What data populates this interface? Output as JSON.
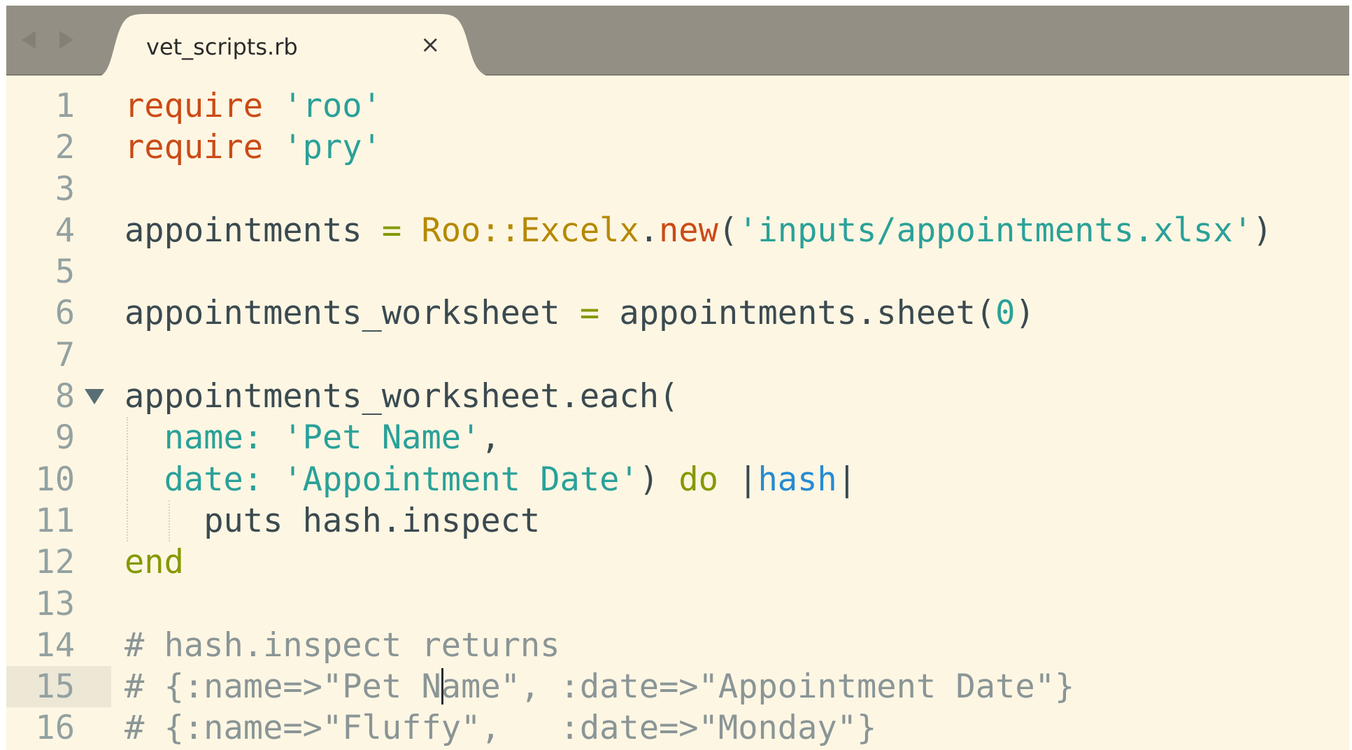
{
  "tab": {
    "title": "vet_scripts.rb",
    "close_label": "×"
  },
  "nav": {
    "back_icon": "back-arrow-icon",
    "forward_icon": "forward-arrow-icon"
  },
  "editor": {
    "current_line": "15",
    "lines": [
      {
        "number": "1"
      },
      {
        "number": "2"
      },
      {
        "number": "3"
      },
      {
        "number": "4"
      },
      {
        "number": "5"
      },
      {
        "number": "6"
      },
      {
        "number": "7"
      },
      {
        "number": "8"
      },
      {
        "number": "9"
      },
      {
        "number": "10"
      },
      {
        "number": "11"
      },
      {
        "number": "12"
      },
      {
        "number": "13"
      },
      {
        "number": "14"
      },
      {
        "number": "15"
      },
      {
        "number": "16"
      }
    ],
    "code": {
      "l1_kw": "require",
      "l1_str": "'roo'",
      "l2_kw": "require",
      "l2_str": "'pry'",
      "l4_var": "appointments",
      "l4_eq": "=",
      "l4_cls": "Roo::Excelx",
      "l4_dot": ".",
      "l4_new": "new",
      "l4_open": "(",
      "l4_str": "'inputs/appointments.xlsx'",
      "l4_close": ")",
      "l6_var": "appointments_worksheet",
      "l6_eq": "=",
      "l6_call": "appointments.sheet(",
      "l6_num": "0",
      "l6_close": ")",
      "l8_text": "appointments_worksheet.each(",
      "l9_sym": "name:",
      "l9_str": "'Pet Name'",
      "l9_comma": ",",
      "l10_sym": "date:",
      "l10_str": "'Appointment Date'",
      "l10_close": ")",
      "l10_do": "do",
      "l10_pipe1": "|",
      "l10_var": "hash",
      "l10_pipe2": "|",
      "l11_text": "puts hash.inspect",
      "l12_end": "end",
      "l14_cmt": "# hash.inspect returns",
      "l15_cmt_a": "# {:name=>\"Pet N",
      "l15_cmt_b": "ame\", :date=>\"Appointment Date\"}",
      "l16_cmt": "# {:name=>\"Fluffy\",   :date=>\"Monday\"}"
    }
  },
  "colors": {
    "background": "#fdf6e3",
    "tabbar": "#948f84",
    "keyword": "#cb4b16",
    "string": "#2aa198",
    "operator": "#859900",
    "class": "#b58900",
    "block_var": "#268bd2",
    "comment": "#8a9596"
  }
}
